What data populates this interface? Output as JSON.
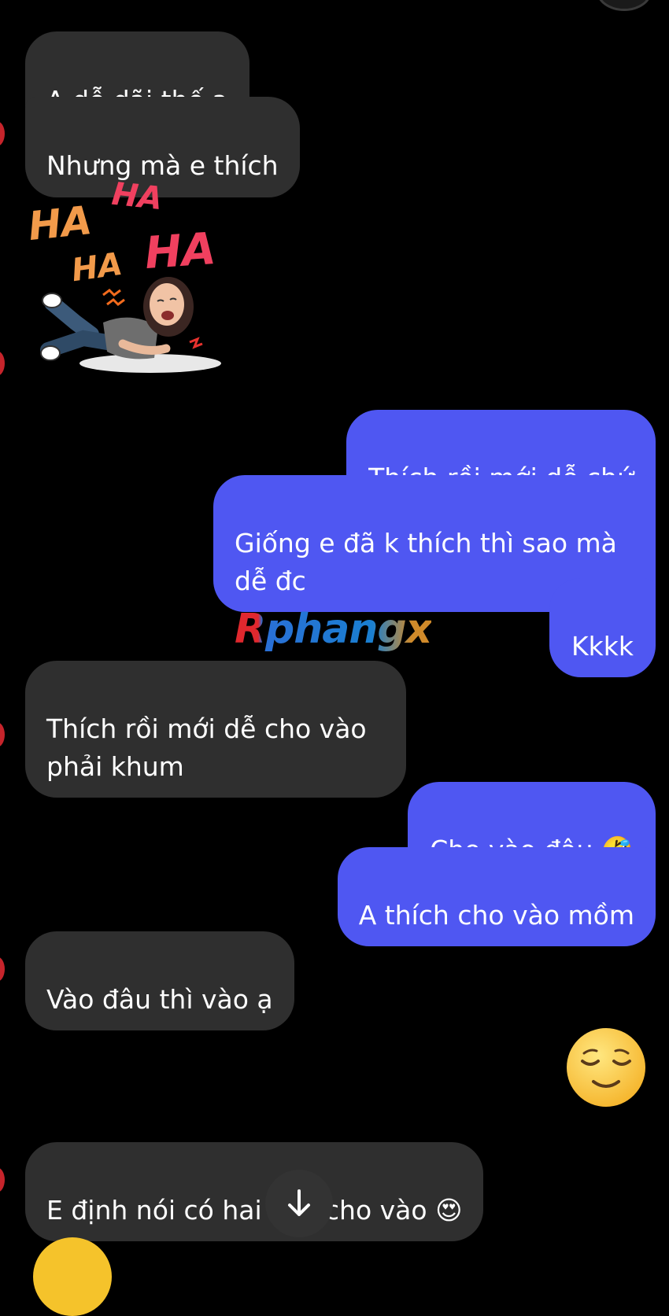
{
  "messages": [
    {
      "id": "m1",
      "side": "in",
      "text": "A dễ dãi thế ạ"
    },
    {
      "id": "m2",
      "side": "in",
      "text": "Nhưng mà e thích"
    },
    {
      "id": "m3",
      "side": "in",
      "type": "sticker",
      "sticker_text": [
        "HA",
        "HA",
        "HA",
        "HA"
      ]
    },
    {
      "id": "m4",
      "side": "out",
      "text": "Thích rồi mới dễ chứ"
    },
    {
      "id": "m5",
      "side": "out",
      "text": "Giống e đã k thích thì sao mà\ndễ đc"
    },
    {
      "id": "m6",
      "side": "out",
      "text": "Kkkk"
    },
    {
      "id": "m7",
      "side": "in",
      "text": "Thích rồi mới dễ cho vào\nphải khum"
    },
    {
      "id": "m8",
      "side": "out",
      "text": "Cho vào đâu 🤣"
    },
    {
      "id": "m9",
      "side": "out",
      "text": "A thích cho vào mồm"
    },
    {
      "id": "m10",
      "side": "in",
      "text": "Vào đâu thì vào ạ"
    },
    {
      "id": "m11",
      "side": "out",
      "type": "emoji",
      "text": "😌"
    },
    {
      "id": "m12",
      "side": "in",
      "text": "E định nói có hai chỗ cho vào 😍"
    }
  ],
  "watermark": {
    "text": "Rphangx"
  },
  "scroll_button": {
    "icon": "arrow-down-icon"
  },
  "colors": {
    "incoming": "#2f2f2f",
    "outgoing": "#4f57f2",
    "background": "#000000"
  }
}
